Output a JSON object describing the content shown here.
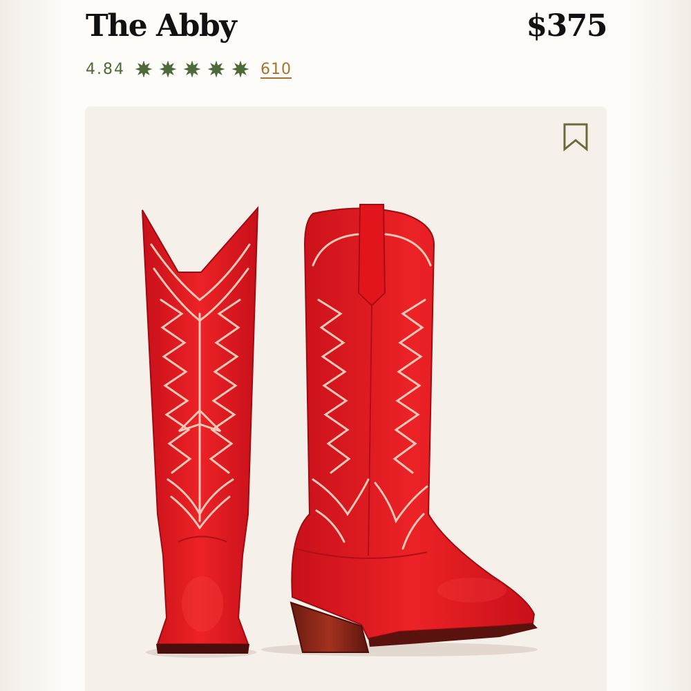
{
  "product": {
    "name": "The Abby",
    "price": "$375",
    "rating": "4.84",
    "stars": 5,
    "review_count": "610"
  },
  "icons": {
    "rating_star": "star-icon",
    "save": "bookmark-icon"
  },
  "colors": {
    "rating_green": "#4d6b3a",
    "link_amber": "#a7712f",
    "boot_red": "#e11b1f",
    "image_background": "#f6f0ea"
  }
}
